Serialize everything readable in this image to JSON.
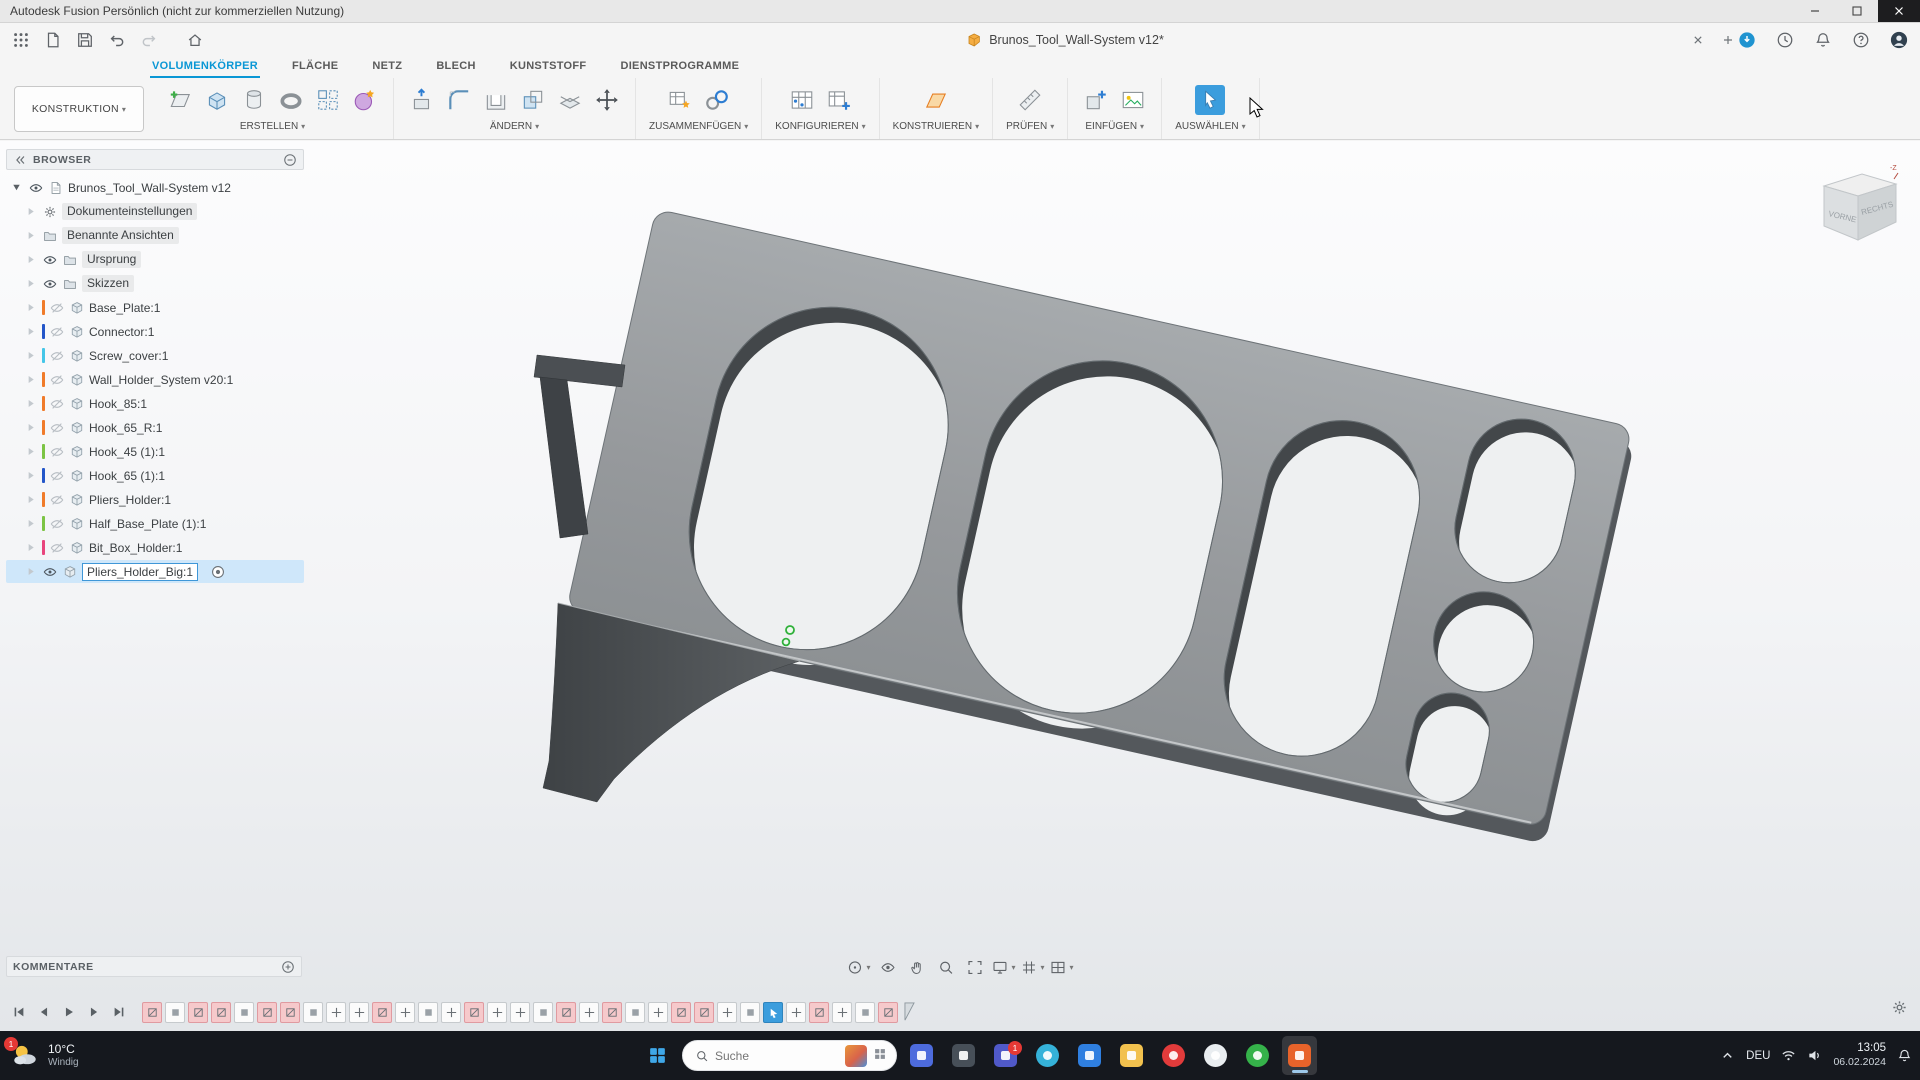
{
  "window": {
    "title": "Autodesk Fusion Persönlich (nicht zur kommerziellen Nutzung)"
  },
  "appbar": {
    "left_icons": [
      "apps-grid",
      "file-menu",
      "save",
      "undo",
      "redo",
      "home"
    ],
    "doc_tab": {
      "label": "Brunos_Tool_Wall-System v12*"
    },
    "right_icons": [
      "job-status",
      "recent-clock",
      "notifications-bell",
      "help",
      "avatar"
    ]
  },
  "toolbar_tabs": {
    "items": [
      {
        "label": "VOLUMENKÖRPER",
        "active": true
      },
      {
        "label": "FLÄCHE"
      },
      {
        "label": "NETZ"
      },
      {
        "label": "BLECH"
      },
      {
        "label": "KUNSTSTOFF"
      },
      {
        "label": "DIENSTPROGRAMME"
      }
    ]
  },
  "ribbon": {
    "workspace_selector": "KONSTRUKTION",
    "accent_color": "#3b9ddd",
    "groups": [
      {
        "label": "ERSTELLEN",
        "icons": [
          "create-sketch",
          "extrude",
          "revolve",
          "sweep",
          "pattern",
          "form"
        ]
      },
      {
        "label": "ÄNDERN",
        "icons": [
          "press-pull",
          "fillet",
          "shell",
          "combine",
          "split",
          "move"
        ]
      },
      {
        "label": "ZUSAMMENFÜGEN",
        "icons": [
          "new-component",
          "joint"
        ]
      },
      {
        "label": "KONFIGURIEREN",
        "icons": [
          "config-table",
          "config-insert"
        ]
      },
      {
        "label": "KONSTRUIEREN",
        "icons": [
          "construction-plane"
        ]
      },
      {
        "label": "PRÜFEN",
        "icons": [
          "measure"
        ]
      },
      {
        "label": "EINFÜGEN",
        "icons": [
          "insert-derive",
          "insert-image"
        ]
      },
      {
        "label": "AUSWÄHLEN",
        "icons": [
          "select"
        ],
        "selected": true
      }
    ]
  },
  "browser": {
    "header": "BROWSER",
    "root_label": "Brunos_Tool_Wall-System v12",
    "folders": [
      {
        "label": "Dokumenteinstellungen",
        "icon": "gear",
        "eye": false
      },
      {
        "label": "Benannte Ansichten",
        "icon": "folder",
        "eye": false
      },
      {
        "label": "Ursprung",
        "icon": "folder",
        "eye": true
      },
      {
        "label": "Skizzen",
        "icon": "folder",
        "eye": true
      }
    ],
    "components": [
      {
        "label": "Base_Plate:1",
        "color": "#f07b2a"
      },
      {
        "label": "Connector:1",
        "color": "#2456c9"
      },
      {
        "label": "Screw_cover:1",
        "color": "#45c6e8"
      },
      {
        "label": "Wall_Holder_System v20:1",
        "color": "#f07b2a"
      },
      {
        "label": "Hook_85:1",
        "color": "#f07b2a"
      },
      {
        "label": "Hook_65_R:1",
        "color": "#f07b2a"
      },
      {
        "label": "Hook_45 (1):1",
        "color": "#7cc444"
      },
      {
        "label": "Hook_65 (1):1",
        "color": "#2456c9"
      },
      {
        "label": "Pliers_Holder:1",
        "color": "#f07b2a"
      },
      {
        "label": "Half_Base_Plate (1):1",
        "color": "#7cc444"
      },
      {
        "label": "Bit_Box_Holder:1",
        "color": "#e8447c"
      },
      {
        "label": "Pliers_Holder_Big:1",
        "color": "#3b9ddd",
        "selected": true
      }
    ]
  },
  "viewcube": {
    "front": "VORNE",
    "right": "RECHTS",
    "axis": "-Z"
  },
  "comments": {
    "header": "KOMMENTARE"
  },
  "navbar": {
    "icons": [
      {
        "name": "orbit",
        "caret": true
      },
      {
        "name": "look-at"
      },
      {
        "name": "pan"
      },
      {
        "name": "zoom"
      },
      {
        "name": "fit"
      },
      {
        "name": "display-settings",
        "caret": true
      },
      {
        "name": "grid-snap",
        "caret": true
      },
      {
        "name": "viewports",
        "caret": true
      }
    ]
  },
  "timeline": {
    "playback": [
      "skip-start",
      "step-back",
      "play",
      "step-forward",
      "skip-end"
    ],
    "tiles": [
      "sketch",
      "feature",
      "sketch",
      "sketch",
      "feature",
      "sketch",
      "sketch",
      "feature",
      "move",
      "move",
      "sketch",
      "move",
      "feature",
      "move",
      "sketch",
      "move",
      "move",
      "feature",
      "sketch",
      "move",
      "sketch",
      "feature",
      "move",
      "sketch",
      "sketch",
      "move",
      "feature",
      "selected",
      "move",
      "sketch",
      "move",
      "feature",
      "sketch"
    ]
  },
  "taskbar": {
    "weather": {
      "temp": "10°C",
      "desc": "Windig",
      "badge": "1"
    },
    "search": {
      "placeholder": "Suche"
    },
    "apps": [
      {
        "name": "widgets",
        "color": "#4d6bdd",
        "shape": "square"
      },
      {
        "name": "terminal",
        "color": "#474f58",
        "shape": "square"
      },
      {
        "name": "teams",
        "color": "#5059c9",
        "shape": "square",
        "badge": "1"
      },
      {
        "name": "edge",
        "color": "#35b2d9",
        "shape": "circle"
      },
      {
        "name": "store",
        "color": "#2f7fe0",
        "shape": "square"
      },
      {
        "name": "explorer",
        "color": "#f2c14e",
        "shape": "square"
      },
      {
        "name": "opera",
        "color": "#e23b3b",
        "shape": "circle"
      },
      {
        "name": "obs",
        "color": "#e9edf0",
        "shape": "circle"
      },
      {
        "name": "whatsapp",
        "color": "#35b24a",
        "shape": "circle"
      },
      {
        "name": "fusion",
        "color": "#e8632a",
        "shape": "square",
        "active": true
      }
    ],
    "tray": {
      "lang": "DEU",
      "time": "13:05",
      "date": "06.02.2024"
    }
  }
}
